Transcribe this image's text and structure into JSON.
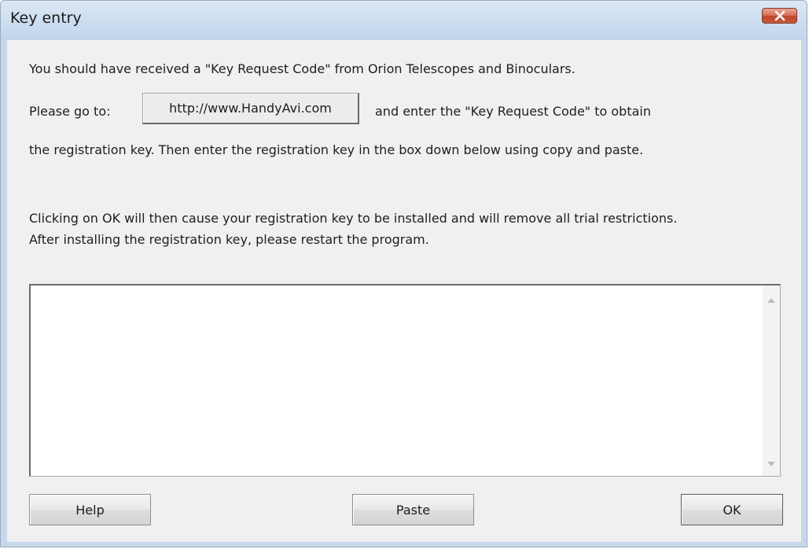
{
  "window": {
    "title": "Key entry"
  },
  "instructions": {
    "line1": "You should have received a \"Key Request Code\" from Orion Telescopes and Binoculars.",
    "goto_prefix": "Please go to:",
    "goto_suffix": "and enter the \"Key Request Code\" to obtain",
    "line3": "the registration key.  Then enter the registration key in the box down below using copy and paste.",
    "info1": "Clicking on OK will then cause your registration key to be installed and will remove all trial restrictions.",
    "info2": "After installing the registration key, please restart the program."
  },
  "link_button": {
    "label": "http://www.HandyAvi.com"
  },
  "key_input": {
    "value": ""
  },
  "buttons": {
    "help": "Help",
    "paste": "Paste",
    "ok": "OK"
  },
  "colors": {
    "title_bar": "#cbdcef",
    "close_button": "#c85a3f",
    "dialog_face": "#f0f0f0"
  }
}
